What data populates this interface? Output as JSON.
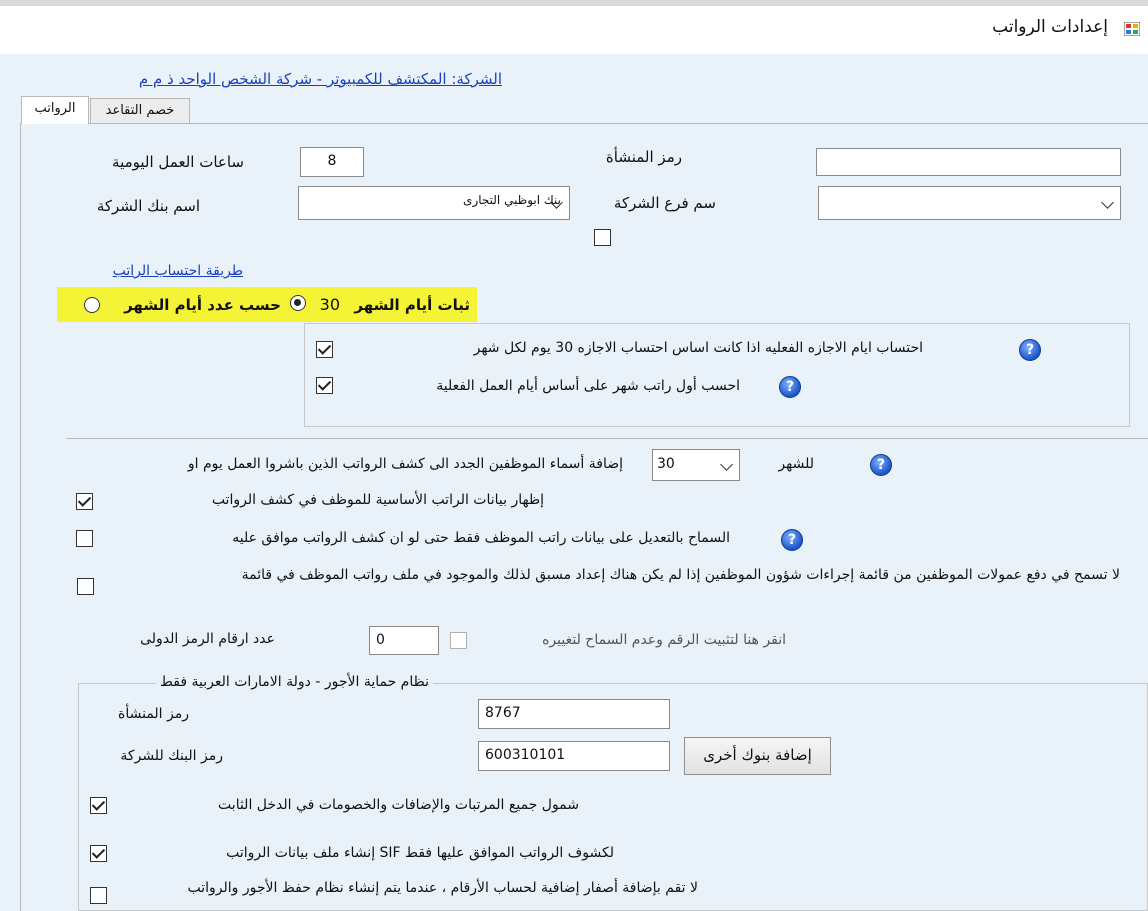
{
  "window": {
    "title": "إعدادات الرواتب",
    "icon": "app-window-icon"
  },
  "company_link": "الشركة: المكتشف للكمبيوتر - شركة الشخص الواحد ذ م م",
  "tabs": [
    {
      "label": "الرواتب",
      "active": true
    },
    {
      "label": "خصم التقاعد",
      "active": false
    }
  ],
  "form": {
    "establishment_code_label": "رمز المنشأة",
    "establishment_code_value": "",
    "daily_hours_label": "ساعات العمل اليومية",
    "daily_hours_value": "8",
    "branch_label": "سم فرع الشركة",
    "branch_value": "",
    "bank_label": "اسم بنك الشركة",
    "bank_value": "بنك ابوظبي التجارى",
    "salary_method_link": "طريقة احتساب الراتب",
    "radio_fixed_days": "ثبات أيام الشهر",
    "radio_fixed_days_number": "30",
    "radio_by_days": "حسب عدد أيام الشهر",
    "chk_leave_days": "احتساب ايام الاجازه الفعليه اذا كانت اساس احتساب الاجازه 30 يوم لكل شهر",
    "chk_first_salary": "احسب أول راتب شهر على أساس أيام العمل الفعلية",
    "add_new_emp_label": "إضافة أسماء الموظفين الجدد الى كشف الرواتب الذين باشروا العمل يوم او",
    "add_new_emp_day": "30",
    "add_new_emp_suffix": "للشهر",
    "chk_show_basic": "إظهار بيانات الراتب الأساسية للموظف في كشف الرواتب",
    "chk_allow_edit": "السماح بالتعديل على بيانات راتب الموظف فقط حتى لو ان كشف الرواتب موافق عليه",
    "chk_no_commissions": "لا تسمح في دفع عمولات الموظفين من قائمة إجراءات شؤون الموظفين إذا لم يكن هناك إعداد مسبق لذلك والموجود في ملف رواتب الموظف في قائمة",
    "intl_digits_label": "عدد ارقام الرمز الدولى",
    "intl_digits_value": "0",
    "fix_number_label": "انقر هنا لتثبيت الرقم وعدم السماح لتغييره"
  },
  "wps": {
    "legend": "نظام حماية الأجور - دولة الامارات العربية فقط",
    "establishment_code_label": "رمز المنشأة",
    "establishment_code_value": "8767",
    "bank_code_label": "رمز البنك للشركة",
    "bank_code_value": "600310101",
    "add_banks_button": "إضافة بنوك أخرى",
    "chk_include_all": "شمول جميع المرتبات والإضافات والخصومات في الدخل الثابت",
    "chk_sif": "لكشوف الرواتب الموافق عليها فقط SIF إنشاء ملف بيانات الرواتب",
    "chk_no_zeros": "لا تقم بإضافة أصفار إضافية لحساب الأرقام ، عندما يتم إنشاء نظام حفظ الأجور والرواتب"
  },
  "colors": {
    "highlight": "#f4f336",
    "link": "#1a3fbf",
    "background": "#eaf2f9"
  }
}
